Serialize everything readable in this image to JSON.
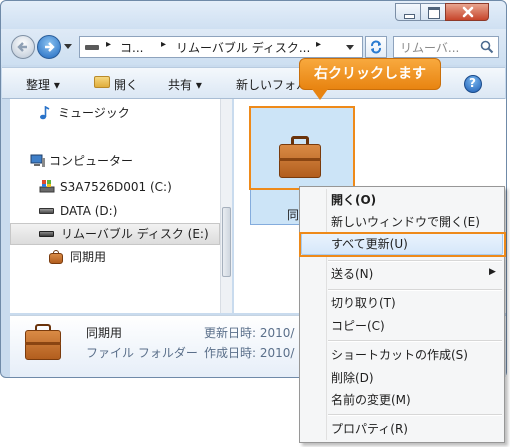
{
  "address": {
    "segments": [
      "コ...",
      "リムーバブル ディスク..."
    ],
    "search_placeholder": "リムーバ..."
  },
  "toolbar": {
    "organize": "整理 ▾",
    "open": "開く",
    "share": "共有 ▾",
    "new_folder": "新しいフォル"
  },
  "callout": {
    "text": "右クリックします"
  },
  "nav": {
    "music": "ミュージック",
    "computer": "コンピューター",
    "drive_c": "S3A7526D001 (C:)",
    "drive_d": "DATA (D:)",
    "drive_e": "リムーバブル ディスク (E:)",
    "briefcase": "同期用"
  },
  "content": {
    "item_label": "同..."
  },
  "details": {
    "name": "同期用",
    "type": "ファイル フォルダー",
    "modified_label": "更新日時: 2010/",
    "created_label": "作成日時: 2010/"
  },
  "context_menu": {
    "items": [
      {
        "label": "開く(O)"
      },
      {
        "label": "新しいウィンドウで開く(E)"
      },
      {
        "label": "すべて更新(U)"
      },
      {
        "label": "送る(N)"
      },
      {
        "label": "切り取り(T)"
      },
      {
        "label": "コピー(C)"
      },
      {
        "label": "ショートカットの作成(S)"
      },
      {
        "label": "削除(D)"
      },
      {
        "label": "名前の変更(M)"
      },
      {
        "label": "プロパティ(R)"
      }
    ]
  },
  "colors": {
    "accent_orange": "#ee8a1a",
    "selection_blue": "#cce4f7"
  }
}
